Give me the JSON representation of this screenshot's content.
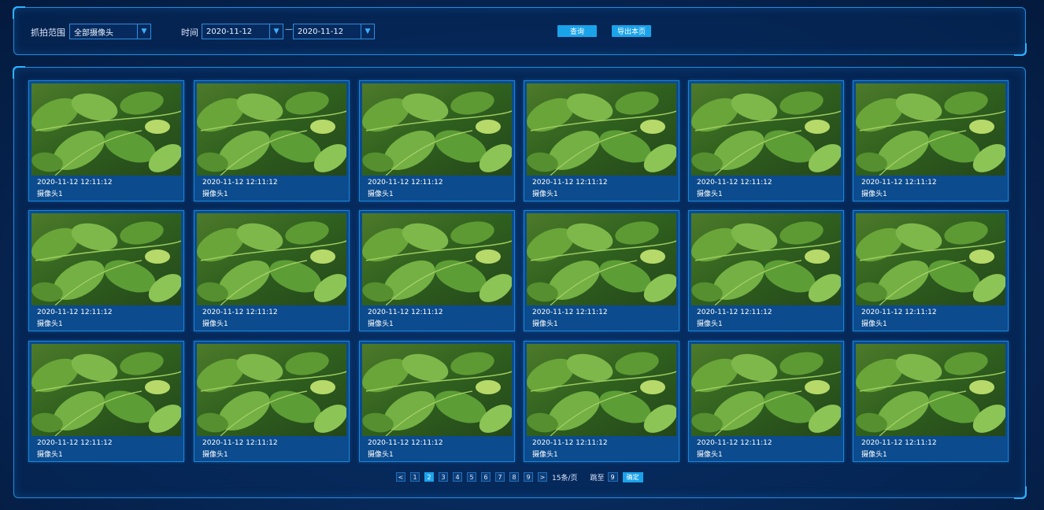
{
  "filters": {
    "range_label": "抓拍范围",
    "range_value": "全部摄像头",
    "time_label": "时间",
    "date_start": "2020-11-12",
    "date_end": "2020-11-12",
    "dash": "—",
    "query_button": "查询",
    "export_button": "导出本页"
  },
  "cards": [
    {
      "time": "2020-11-12  12:11:12",
      "camera": "摄像头1"
    },
    {
      "time": "2020-11-12  12:11:12",
      "camera": "摄像头1"
    },
    {
      "time": "2020-11-12  12:11:12",
      "camera": "摄像头1"
    },
    {
      "time": "2020-11-12  12:11:12",
      "camera": "摄像头1"
    },
    {
      "time": "2020-11-12  12:11:12",
      "camera": "摄像头1"
    },
    {
      "time": "2020-11-12  12:11:12",
      "camera": "摄像头1"
    },
    {
      "time": "2020-11-12  12:11:12",
      "camera": "摄像头1"
    },
    {
      "time": "2020-11-12  12:11:12",
      "camera": "摄像头1"
    },
    {
      "time": "2020-11-12  12:11:12",
      "camera": "摄像头1"
    },
    {
      "time": "2020-11-12  12:11:12",
      "camera": "摄像头1"
    },
    {
      "time": "2020-11-12  12:11:12",
      "camera": "摄像头1"
    },
    {
      "time": "2020-11-12  12:11:12",
      "camera": "摄像头1"
    },
    {
      "time": "2020-11-12  12:11:12",
      "camera": "摄像头1"
    },
    {
      "time": "2020-11-12  12:11:12",
      "camera": "摄像头1"
    },
    {
      "time": "2020-11-12  12:11:12",
      "camera": "摄像头1"
    },
    {
      "time": "2020-11-12  12:11:12",
      "camera": "摄像头1"
    },
    {
      "time": "2020-11-12  12:11:12",
      "camera": "摄像头1"
    },
    {
      "time": "2020-11-12  12:11:12",
      "camera": "摄像头1"
    }
  ],
  "pagination": {
    "prev": "<",
    "next": ">",
    "pages": [
      "1",
      "2",
      "3",
      "4",
      "5",
      "6",
      "7",
      "8",
      "9"
    ],
    "active_page": "2",
    "per_page": "15条/页",
    "jump_label": "跳至",
    "jump_value": "9",
    "confirm": "确定"
  },
  "colors": {
    "accent": "#1ba3ea",
    "border": "#1f8de0",
    "background": "#072a5c"
  }
}
